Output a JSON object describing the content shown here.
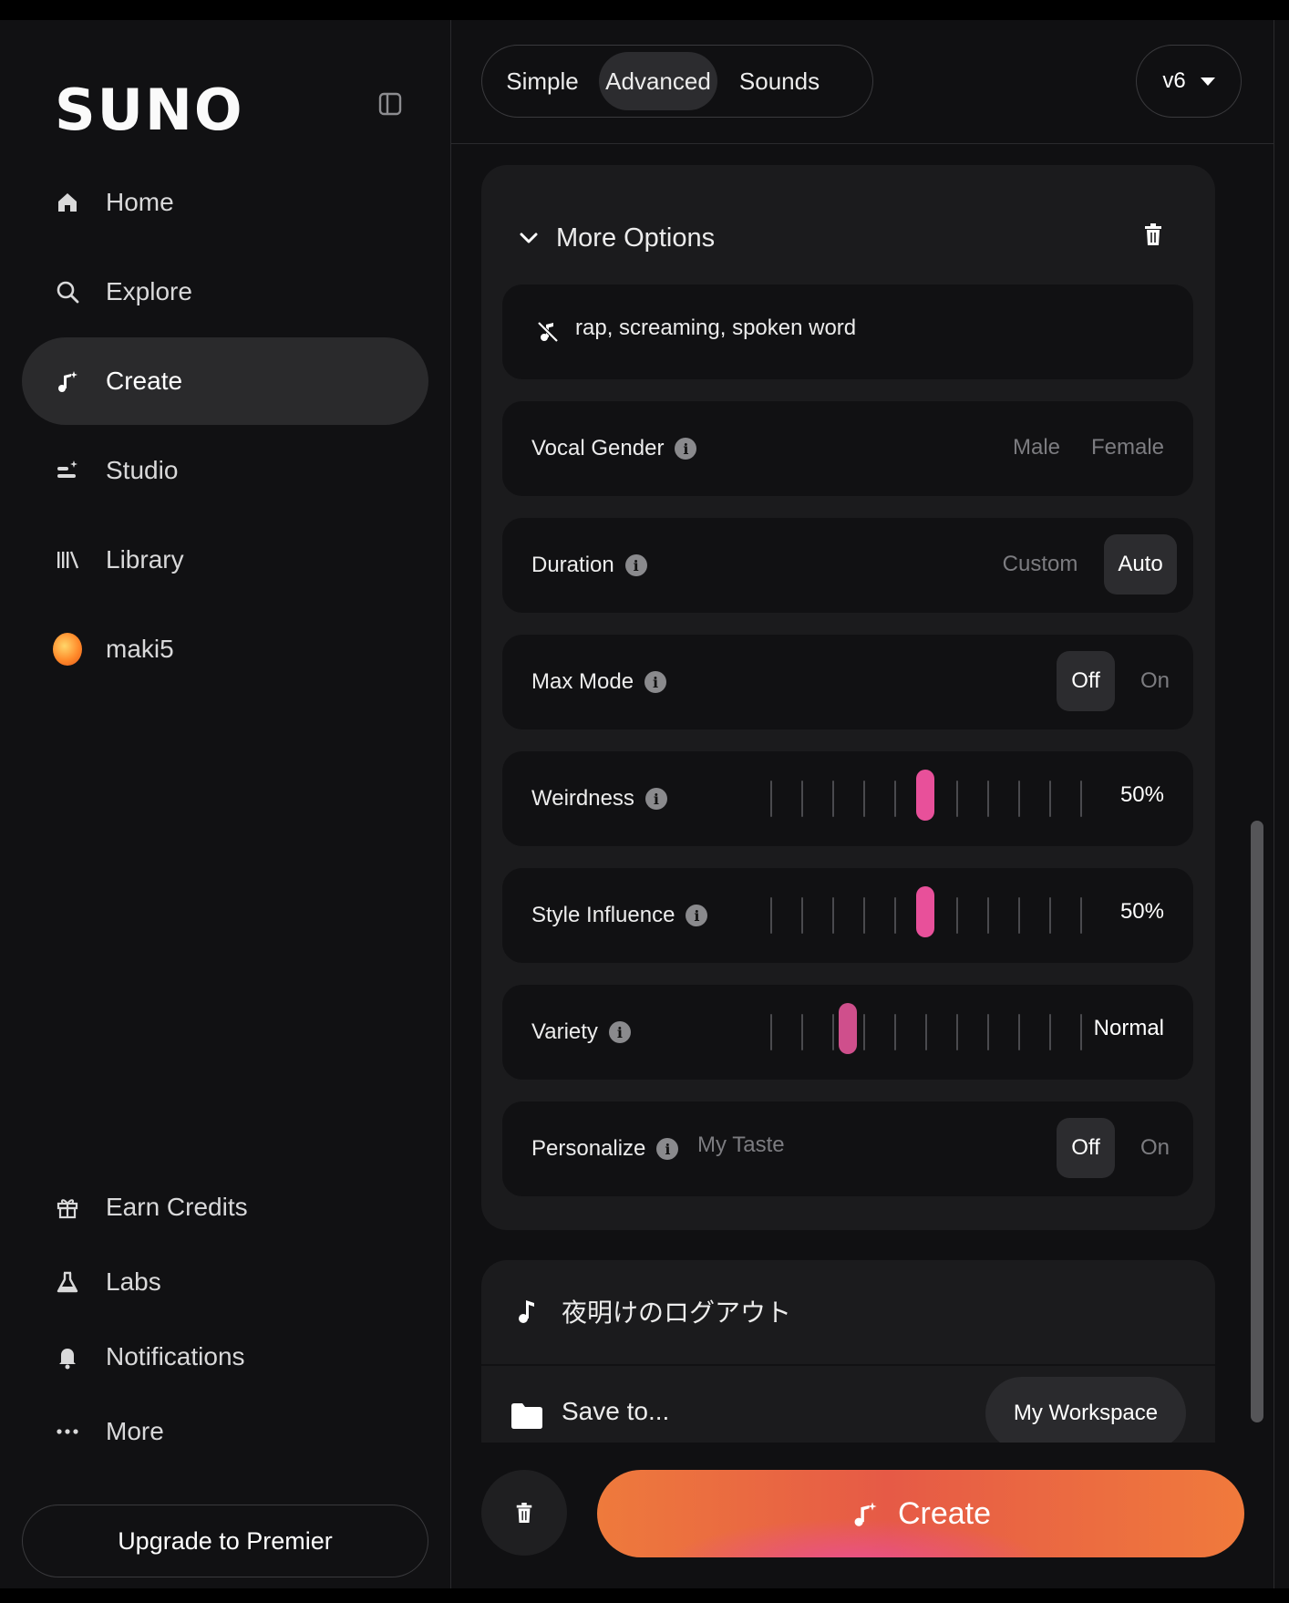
{
  "app": {
    "logo": "SUNO"
  },
  "sidebar": {
    "items": [
      {
        "label": "Home",
        "icon": "home-icon"
      },
      {
        "label": "Explore",
        "icon": "search-icon"
      },
      {
        "label": "Create",
        "icon": "create-icon",
        "active": true
      },
      {
        "label": "Studio",
        "icon": "studio-icon"
      },
      {
        "label": "Library",
        "icon": "library-icon"
      },
      {
        "label": "maki5",
        "icon": "avatar"
      }
    ],
    "bottom_items": [
      {
        "label": "Earn Credits",
        "icon": "gift-icon"
      },
      {
        "label": "Labs",
        "icon": "flask-icon"
      },
      {
        "label": "Notifications",
        "icon": "bell-icon"
      },
      {
        "label": "More",
        "icon": "more-icon"
      }
    ],
    "upgrade_label": "Upgrade to Premier"
  },
  "header": {
    "tabs": [
      "Simple",
      "Advanced",
      "Sounds"
    ],
    "active_tab": "Advanced",
    "version": "v6"
  },
  "options": {
    "title": "More Options",
    "exclude_styles": "rap, screaming, spoken word",
    "vocal_gender": {
      "label": "Vocal Gender",
      "options": [
        "Male",
        "Female"
      ]
    },
    "duration": {
      "label": "Duration",
      "options": [
        "Custom",
        "Auto"
      ],
      "selected": "Auto"
    },
    "max_mode": {
      "label": "Max Mode",
      "options": [
        "Off",
        "On"
      ],
      "selected": "Off"
    },
    "weirdness": {
      "label": "Weirdness",
      "value": 50,
      "display": "50%"
    },
    "style_influence": {
      "label": "Style Influence",
      "value": 50,
      "display": "50%"
    },
    "variety": {
      "label": "Variety",
      "value": 25,
      "display": "Normal"
    },
    "personalize": {
      "label": "Personalize",
      "sub": "My Taste",
      "options": [
        "Off",
        "On"
      ],
      "selected": "Off"
    }
  },
  "song": {
    "title": "夜明けのログアウト",
    "save_label": "Save to...",
    "workspace": "My Workspace"
  },
  "actions": {
    "create_label": "Create"
  },
  "colors": {
    "accent_pink": "#e8509a",
    "create_orange": "#ee7a3c"
  }
}
